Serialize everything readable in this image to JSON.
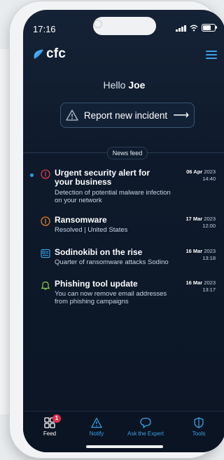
{
  "status": {
    "time": "17:16"
  },
  "app": {
    "logo_text": "cfc"
  },
  "greeting": {
    "prefix": "Hello",
    "name": "Joe"
  },
  "report_button": {
    "label": "Report new incident"
  },
  "news_feed": {
    "label": "News feed",
    "items": [
      {
        "title": "Urgent security alert for your business",
        "description": "Detection of potential malware infection on your network",
        "date": "06 Apr",
        "year": "2023",
        "time": "14:40",
        "unread": true,
        "icon": "alert-shield-icon",
        "color": "#e03a4c"
      },
      {
        "title": "Ransomware",
        "description": "Resolved | United States",
        "date": "17 Mar",
        "year": "2023",
        "time": "12:00",
        "unread": false,
        "icon": "alert-shield-icon",
        "color": "#e07a2a"
      },
      {
        "title": "Sodinokibi on the rise",
        "description": "Quarter of ransomware attacks Sodino",
        "date": "16 Mar",
        "year": "2023",
        "time": "13:18",
        "unread": false,
        "icon": "newspaper-icon",
        "color": "#3aa1e6"
      },
      {
        "title": "Phishing tool update",
        "description": "You can now remove email addresses from phishing campaigns",
        "date": "16 Mar",
        "year": "2023",
        "time": "13:17",
        "unread": false,
        "icon": "bell-icon",
        "color": "#8bd04a"
      }
    ]
  },
  "tabbar": {
    "feed": {
      "label": "Feed",
      "badge": "1"
    },
    "notify": {
      "label": "Notify"
    },
    "ask": {
      "label": "Ask the Expert"
    },
    "tools": {
      "label": "Tools"
    }
  }
}
